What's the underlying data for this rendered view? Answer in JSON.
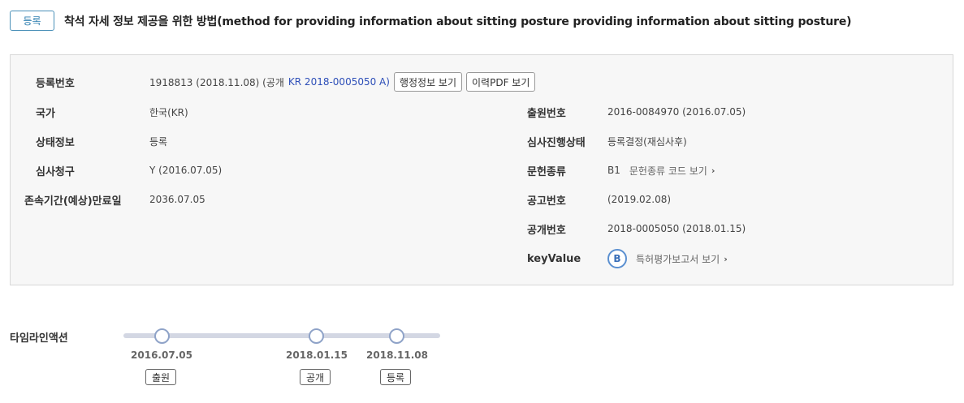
{
  "header": {
    "status_tag": "등록",
    "title": "착석 자세 정보 제공을 위한 방법(method for providing information about sitting posture providing information about sitting posture)"
  },
  "info": {
    "reg_no": {
      "label": "등록번호",
      "value_pre": "1918813 (2018.11.08) (공개",
      "link": "KR 2018-0005050 A)",
      "btn_admin": "행정정보 보기",
      "btn_pdf": "이력PDF 보기"
    },
    "country": {
      "label": "국가",
      "value": "한국(KR)"
    },
    "status": {
      "label": "상태정보",
      "value": "등록"
    },
    "exam_request": {
      "label": "심사청구",
      "value": "Y (2016.07.05)"
    },
    "duration": {
      "label": "존속기간(예상)만료일",
      "value": "2036.07.05"
    },
    "app_no": {
      "label": "출원번호",
      "value": "2016-0084970 (2016.07.05)"
    },
    "exam_progress": {
      "label": "심사진행상태",
      "value": "등록결정(재심사후)"
    },
    "doc_type": {
      "label": "문헌종류",
      "value": "B1",
      "link": "문헌종류 코드 보기"
    },
    "notice_no": {
      "label": "공고번호",
      "value": "(2019.02.08)"
    },
    "pub_no": {
      "label": "공개번호",
      "value": "2018-0005050 (2018.01.15)"
    },
    "key_value": {
      "label": "keyValue",
      "badge": "B",
      "link": "특허평가보고서 보기"
    }
  },
  "timeline": {
    "label": "타임라인액션",
    "events": [
      {
        "date": "2016.07.05",
        "tag": "출원"
      },
      {
        "date": "2018.01.15",
        "tag": "공개"
      },
      {
        "date": "2018.11.08",
        "tag": "등록"
      }
    ]
  },
  "colors": {
    "accent": "#2f7fb0",
    "link": "#2e4fb8",
    "timeline": "#8fa3c8"
  }
}
